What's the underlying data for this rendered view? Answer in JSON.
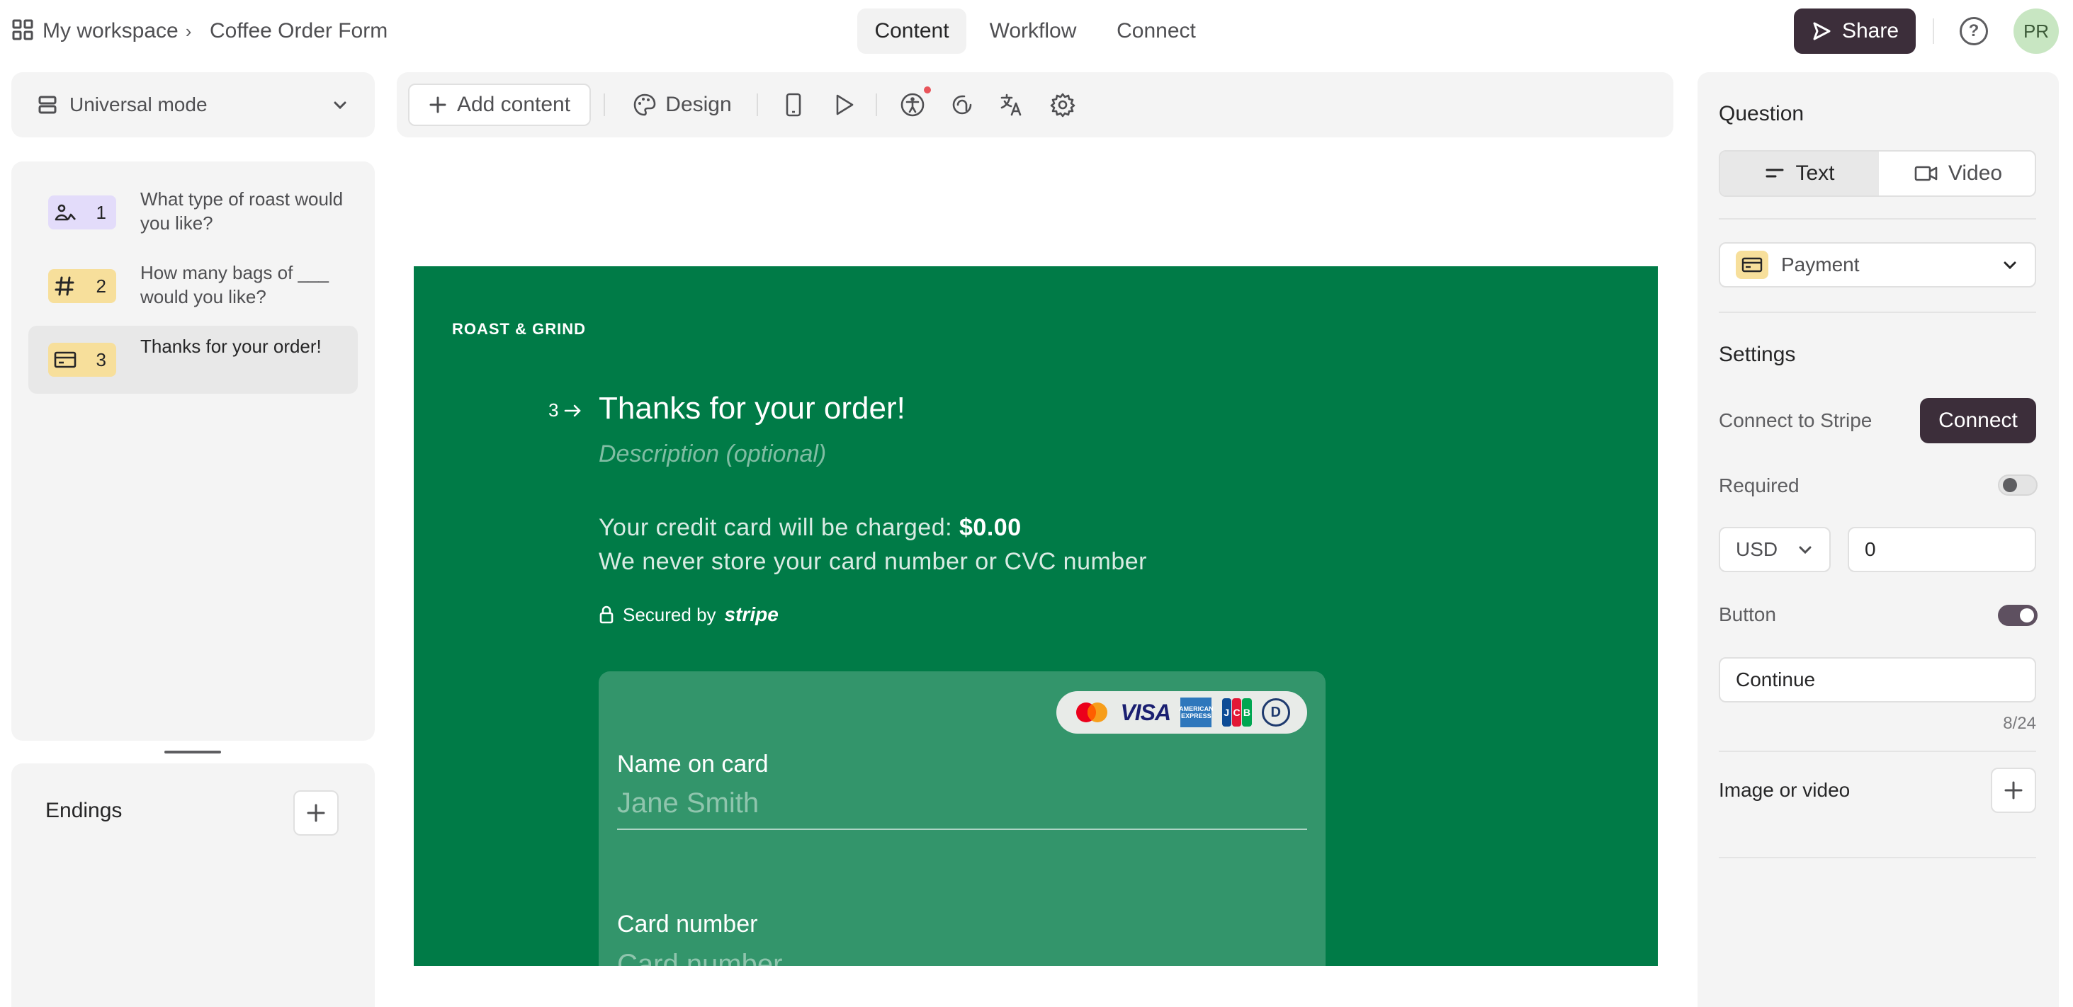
{
  "breadcrumb": {
    "workspace": "My workspace",
    "form": "Coffee Order Form"
  },
  "nav": {
    "tabs": [
      {
        "label": "Content",
        "active": true
      },
      {
        "label": "Workflow",
        "active": false
      },
      {
        "label": "Connect",
        "active": false
      }
    ]
  },
  "header": {
    "share_label": "Share",
    "help_icon": "help-icon",
    "avatar_initials": "PR"
  },
  "left": {
    "mode_label": "Universal mode",
    "questions": [
      {
        "num": "1",
        "text": "What type of roast would you like?",
        "icon": "picture-choice-icon",
        "badge_color": "#e3dcfa"
      },
      {
        "num": "2",
        "text": "How many bags of ___ would you like?",
        "icon": "hash-icon",
        "badge_color": "#f7df9b"
      },
      {
        "num": "3",
        "text": "Thanks for your order!",
        "icon": "credit-card-icon",
        "badge_color": "#f7df9b",
        "active": true
      }
    ],
    "endings_label": "Endings"
  },
  "toolbar": {
    "add_content": "Add content",
    "design": "Design"
  },
  "canvas": {
    "brand": "ROAST & GRIND",
    "question_number": "3",
    "question_title": "Thanks for your order!",
    "description_placeholder": "Description (optional)",
    "charge_prefix": "Your credit card will be charged: ",
    "charge_amount": "$0.00",
    "store_notice": "We never store your card number or CVC number",
    "secured_by": "Secured by",
    "stripe_word": "stripe",
    "card_brands": [
      "mastercard",
      "visa",
      "amex",
      "jcb",
      "diners"
    ],
    "visa_text": "VISA",
    "amex_text": "AMERICAN EXPRESS",
    "jcb_letters": [
      "J",
      "C",
      "B"
    ],
    "diners_text": "D",
    "name_label": "Name on card",
    "name_placeholder": "Jane Smith",
    "card_label": "Card number",
    "card_placeholder": "Card number",
    "bg_color": "#007b47"
  },
  "right": {
    "question_heading": "Question",
    "segment": [
      {
        "label": "Text",
        "active": true
      },
      {
        "label": "Video",
        "active": false
      }
    ],
    "type_label": "Payment",
    "settings_heading": "Settings",
    "connect_label": "Connect to Stripe",
    "connect_button": "Connect",
    "required_label": "Required",
    "required_on": false,
    "currency": "USD",
    "amount": "0",
    "button_label": "Button",
    "button_on": true,
    "button_text": "Continue",
    "char_count": "8/24",
    "image_label": "Image or video"
  }
}
